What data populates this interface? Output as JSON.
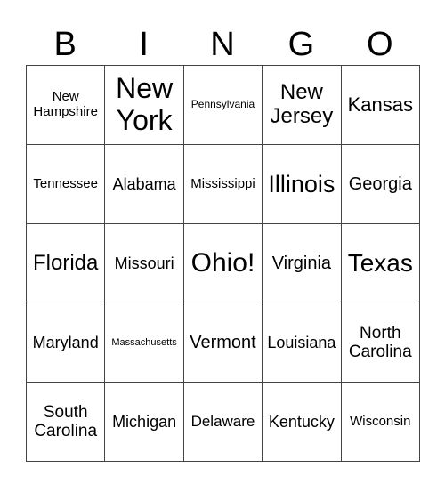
{
  "header": [
    "B",
    "I",
    "N",
    "G",
    "O"
  ],
  "cells": [
    [
      {
        "text": "New Hampshire",
        "size": 15
      },
      {
        "text": "New York",
        "size": 32
      },
      {
        "text": "Pennsylvania",
        "size": 12
      },
      {
        "text": "New Jersey",
        "size": 24
      },
      {
        "text": "Kansas",
        "size": 22
      }
    ],
    [
      {
        "text": "Tennessee",
        "size": 15
      },
      {
        "text": "Alabama",
        "size": 18
      },
      {
        "text": "Mississippi",
        "size": 15
      },
      {
        "text": "Illinois",
        "size": 27
      },
      {
        "text": "Georgia",
        "size": 20
      }
    ],
    [
      {
        "text": "Florida",
        "size": 24
      },
      {
        "text": "Missouri",
        "size": 18
      },
      {
        "text": "Ohio!",
        "size": 30
      },
      {
        "text": "Virginia",
        "size": 20
      },
      {
        "text": "Texas",
        "size": 28
      }
    ],
    [
      {
        "text": "Maryland",
        "size": 18
      },
      {
        "text": "Massachusetts",
        "size": 11
      },
      {
        "text": "Vermont",
        "size": 20
      },
      {
        "text": "Louisiana",
        "size": 18
      },
      {
        "text": "North Carolina",
        "size": 19
      }
    ],
    [
      {
        "text": "South Carolina",
        "size": 19
      },
      {
        "text": "Michigan",
        "size": 18
      },
      {
        "text": "Delaware",
        "size": 17
      },
      {
        "text": "Kentucky",
        "size": 18
      },
      {
        "text": "Wisconsin",
        "size": 15
      }
    ]
  ]
}
